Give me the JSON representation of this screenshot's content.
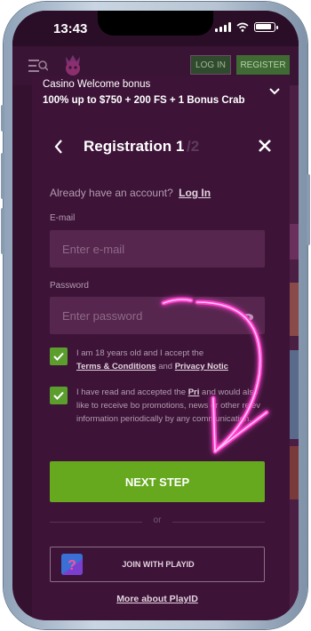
{
  "status_bar": {
    "time": "13:43"
  },
  "header": {
    "login_label": "LOG IN",
    "register_label": "REGISTER"
  },
  "bonus": {
    "title": "Casino Welcome bonus",
    "offer": "100% up to $750 + 200 FS + 1 Bonus Crab"
  },
  "registration": {
    "title": "Registration 1",
    "step_total": "/2",
    "account_prompt": "Already have an account?",
    "login_link": "Log In",
    "email_label": "E-mail",
    "email_placeholder": "Enter e-mail",
    "password_label": "Password",
    "password_placeholder": "Enter password",
    "age_check": {
      "text_prefix": "I am 18 years old and I accept the",
      "terms_link": "Terms & Conditions",
      "and": "and",
      "privacy_link": "Privacy Notic"
    },
    "promo_check": {
      "line1": "I have read and accepted the",
      "link": "Pri",
      "rest": "and would also like to receive bo promotions, news or other relev information periodically by any communication."
    },
    "next_label": "NEXT STEP",
    "or_label": "or",
    "playid_label": "JOIN WITH PLAYID",
    "more_playid": "More about PlayID"
  },
  "colors": {
    "background": "#34112f",
    "modal": "#3d1438",
    "input": "#57264f",
    "accent_green": "#66a91f",
    "annotation_arrow": "#ff3fd0"
  },
  "icons": [
    "back-arrow-icon",
    "close-icon",
    "chevron-down-icon",
    "eye-icon",
    "checkmark-icon",
    "playid-icon",
    "hamburger-search-icon",
    "logo-icon"
  ]
}
